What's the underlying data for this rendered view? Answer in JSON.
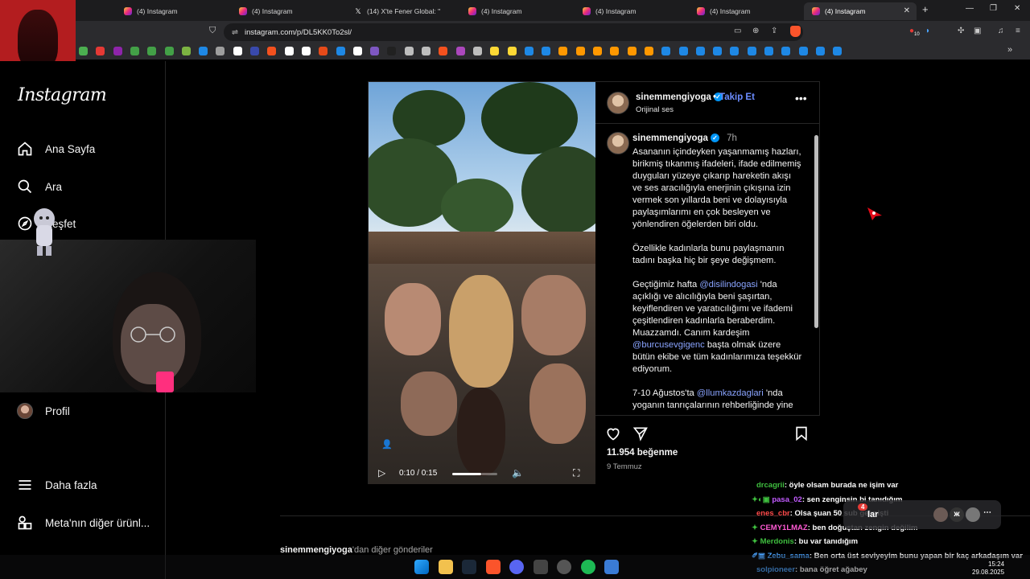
{
  "browser": {
    "tabs": [
      {
        "label": "(4) Instagram",
        "icon": "instagram-icon"
      },
      {
        "label": "(4) Instagram",
        "icon": "instagram-icon"
      },
      {
        "label": "(14) X'te Fener Global: \"",
        "icon": "x-icon"
      },
      {
        "label": "(4) Instagram",
        "icon": "instagram-icon"
      },
      {
        "label": "(4) Instagram",
        "icon": "instagram-icon"
      },
      {
        "label": "(4) Instagram",
        "icon": "instagram-icon"
      },
      {
        "label": "(4) Instagram",
        "icon": "instagram-icon"
      }
    ],
    "active_tab_index": 6,
    "url": "instagram.com/p/DL5KK0To2sl/",
    "extension_badge": "10"
  },
  "sidebar": {
    "logo": "Instagram",
    "items": [
      {
        "label": "Ana Sayfa",
        "icon": "home-icon"
      },
      {
        "label": "Ara",
        "icon": "search-icon"
      },
      {
        "label": "Keşfet",
        "icon": "compass-icon"
      },
      {
        "label": "Profil",
        "icon": "profile-avatar"
      },
      {
        "label": "Daha fazla",
        "icon": "menu-icon"
      },
      {
        "label": "Meta'nın diğer ürünl...",
        "icon": "meta-apps-icon"
      }
    ]
  },
  "post": {
    "username": "sinemmengiyoga",
    "separator": "•",
    "follow_label": "Takip Et",
    "audio": "Orijinal ses",
    "caption_time": "7h",
    "caption_paragraphs": [
      "Asananın içindeyken yaşanmamış hazları, birikmiş tıkanmış ifadeleri, ifade edilmemiş duyguları yüzeye çıkarıp hareketin akışı ve ses aracılığıyla enerjinin çıkışına izin vermek son yıllarda beni ve dolayısıyla paylaşımlarımı en çok besleyen ve yönlendiren öğelerden biri oldu.",
      "Özellikle kadınlarla bunu paylaşmanın tadını başka hiç bir şeye değişmem."
    ],
    "para3": {
      "pre": "Geçtiğimiz hafta ",
      "mention1": "@disilindogasi",
      "mid1": " 'nda açıklığı ve alıcılığıyla beni şaşırtan, keyiflendiren ve yaratıcılığımı ve ifademi çeşitlendiren kadınlarla beraberdim. Muazzamdı. Canım kardeşim ",
      "mention2": "@burcusevgigenc",
      "post": " başta olmak üzere bütün ekibe ve tüm kadınlarımıza teşekkür ediyorum."
    },
    "para4": {
      "pre": "7-10 Ağustos'ta ",
      "mention": "@llumkazdaglari",
      "post": " 'nda yoganın tanrıçalarının rehberliğinde yine"
    },
    "likes": "11.954 beğenme",
    "date": "9 Temmuz",
    "video_time": "0:10 / 0:15",
    "video_progress": 0.67,
    "more_posts_user": "sinemmengiyoga",
    "more_posts_suffix": "'dan diğer gönderiler"
  },
  "chat": [
    {
      "user": "drcagrii",
      "msg": ": öyle olsam burada ne işim var"
    },
    {
      "user": "pasa_02",
      "msg": ": sen zenginsin bi tanıdığım"
    },
    {
      "user": "enes_cbr",
      "msg": ": Olsa şuan 50 sub gelmişti"
    },
    {
      "user": "CEMY1LMAZ",
      "msg": ": ben doğuştan zengin değilim"
    },
    {
      "user": "Merdonis",
      "msg": ": bu var tanıdığım"
    },
    {
      "user": "Zebu_sama",
      "msg": ": Ben orta üst seviyeyim bunu yapan bir kaç arkadaşım var"
    },
    {
      "user": "solpioneer",
      "msg": ": bana öğret ağabey"
    }
  ],
  "mediabar": {
    "badge": "4",
    "text": "lar"
  },
  "clock": {
    "time": "15:24",
    "date": "29.08.2025"
  },
  "colors": {
    "accent": "#0095f6",
    "mention": "#8aa4ff",
    "follow": "#6b8cff",
    "bg": "#000000"
  }
}
